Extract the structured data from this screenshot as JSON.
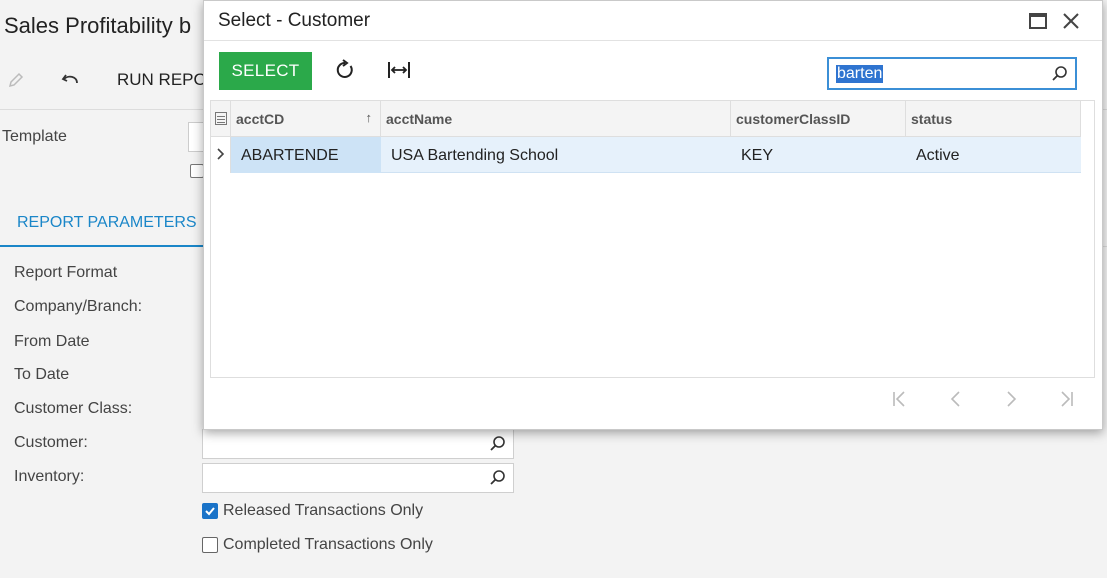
{
  "page": {
    "title": "Sales Profitability b",
    "toolbar": {
      "run_label": "RUN REPO"
    },
    "template_label": "Template",
    "tab_active": "REPORT PARAMETERS",
    "params": {
      "report_format": "Report Format",
      "company_branch": "Company/Branch:",
      "from_date": "From Date",
      "to_date": "To Date",
      "customer_class": "Customer Class:",
      "customer": "Customer:",
      "inventory": "Inventory:"
    },
    "checks": {
      "released": {
        "label": "Released Transactions Only",
        "checked": true
      },
      "completed": {
        "label": "Completed Transactions Only",
        "checked": false
      }
    }
  },
  "dialog": {
    "title": "Select - Customer",
    "select_label": "SELECT",
    "search_value": "barten",
    "columns": [
      "acctCD",
      "acctName",
      "customerClassID",
      "status"
    ],
    "rows": [
      {
        "acctCD": "ABARTENDE",
        "acctName": "USA Bartending School",
        "customerClassID": "KEY",
        "status": "Active"
      }
    ]
  },
  "colors": {
    "accent": "#1a86c8",
    "select_button": "#2ba94a",
    "row_highlight": "#e6f1fb"
  }
}
